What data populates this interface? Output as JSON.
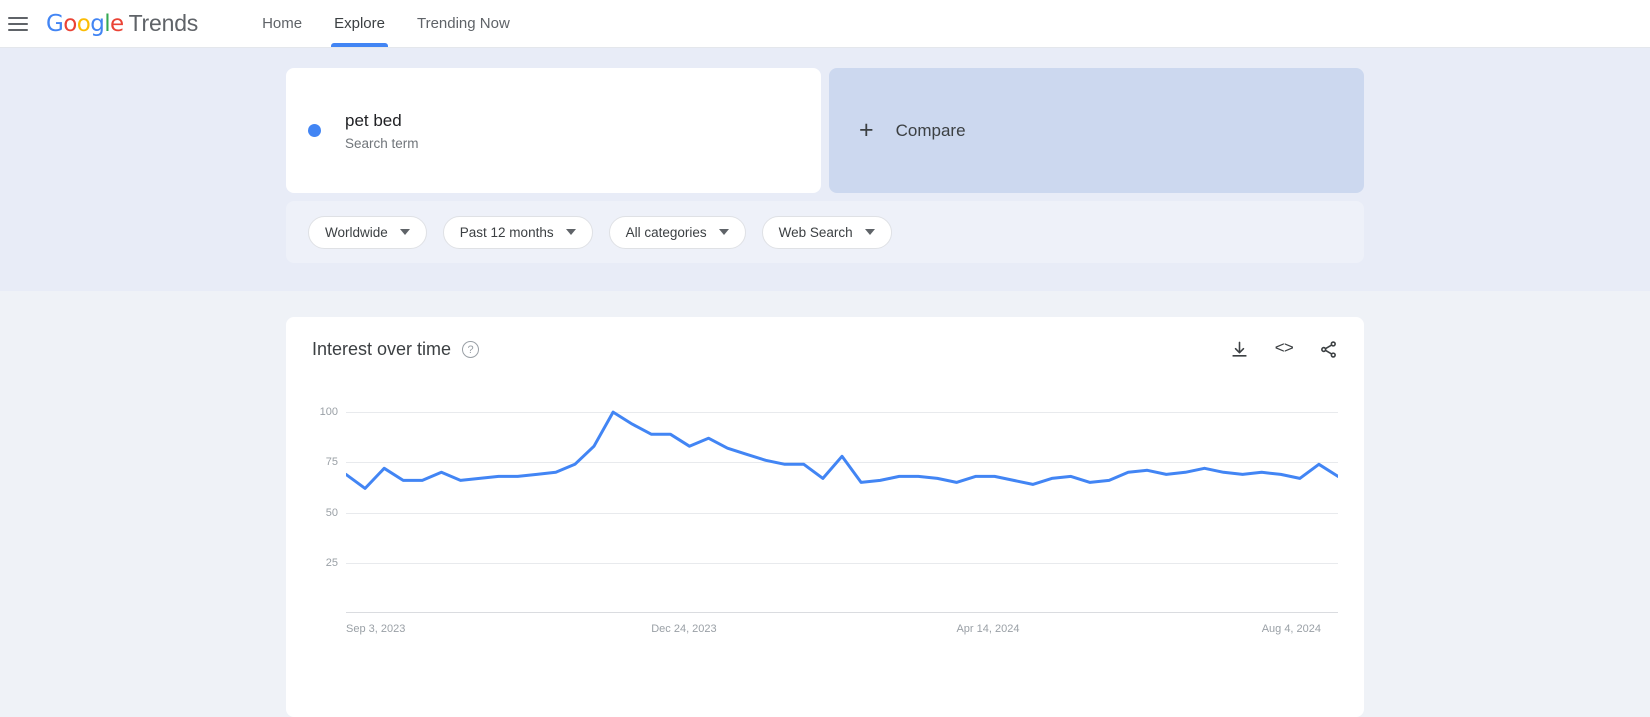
{
  "nav": {
    "menu_icon": "hamburger-icon",
    "logo_letters": [
      {
        "ch": "G",
        "color": "#4285F4"
      },
      {
        "ch": "o",
        "color": "#EA4335"
      },
      {
        "ch": "o",
        "color": "#FBBC05"
      },
      {
        "ch": "g",
        "color": "#4285F4"
      },
      {
        "ch": "l",
        "color": "#34A853"
      },
      {
        "ch": "e",
        "color": "#EA4335"
      }
    ],
    "brand_word": "Trends",
    "links": [
      {
        "label": "Home",
        "active": false
      },
      {
        "label": "Explore",
        "active": true
      },
      {
        "label": "Trending Now",
        "active": false
      }
    ]
  },
  "search_term": {
    "title": "pet bed",
    "subtitle": "Search term",
    "dot_color": "#4285F4"
  },
  "compare": {
    "plus": "+",
    "label": "Compare"
  },
  "filters": [
    {
      "label": "Worldwide"
    },
    {
      "label": "Past 12 months"
    },
    {
      "label": "All categories"
    },
    {
      "label": "Web Search"
    }
  ],
  "chart_card": {
    "title": "Interest over time",
    "help_glyph": "?",
    "actions": [
      {
        "name": "download-icon"
      },
      {
        "name": "embed-icon",
        "glyph": "<>"
      },
      {
        "name": "share-icon"
      }
    ]
  },
  "chart_data": {
    "type": "line",
    "title": "Interest over time",
    "xlabel": "",
    "ylabel": "",
    "ylim": [
      0,
      107
    ],
    "yticks": [
      100,
      75,
      50,
      25
    ],
    "grid": true,
    "legend": false,
    "line_color": "#4285F4",
    "xtick_labels": [
      "Sep 3, 2023",
      "Dec 24, 2023",
      "Apr 14, 2024",
      "Aug 4, 2024"
    ],
    "xtick_positions": [
      0,
      16,
      32,
      48
    ],
    "x": [
      "Sep 3, 2023",
      "Sep 10, 2023",
      "Sep 17, 2023",
      "Sep 24, 2023",
      "Oct 1, 2023",
      "Oct 8, 2023",
      "Oct 15, 2023",
      "Oct 22, 2023",
      "Oct 29, 2023",
      "Nov 5, 2023",
      "Nov 12, 2023",
      "Nov 19, 2023",
      "Nov 26, 2023",
      "Dec 3, 2023",
      "Dec 10, 2023",
      "Dec 17, 2023",
      "Dec 24, 2023",
      "Dec 31, 2023",
      "Jan 7, 2024",
      "Jan 14, 2024",
      "Jan 21, 2024",
      "Jan 28, 2024",
      "Feb 4, 2024",
      "Feb 11, 2024",
      "Feb 18, 2024",
      "Feb 25, 2024",
      "Mar 3, 2024",
      "Mar 10, 2024",
      "Mar 17, 2024",
      "Mar 24, 2024",
      "Mar 31, 2024",
      "Apr 7, 2024",
      "Apr 14, 2024",
      "Apr 21, 2024",
      "Apr 28, 2024",
      "May 5, 2024",
      "May 12, 2024",
      "May 19, 2024",
      "May 26, 2024",
      "Jun 2, 2024",
      "Jun 9, 2024",
      "Jun 16, 2024",
      "Jun 23, 2024",
      "Jun 30, 2024",
      "Jul 7, 2024",
      "Jul 14, 2024",
      "Jul 21, 2024",
      "Jul 28, 2024",
      "Aug 4, 2024",
      "Aug 11, 2024",
      "Aug 18, 2024",
      "Aug 25, 2024",
      "Sep 1, 2024"
    ],
    "values": [
      69,
      62,
      72,
      66,
      66,
      70,
      66,
      67,
      68,
      68,
      69,
      70,
      74,
      83,
      100,
      94,
      89,
      89,
      83,
      87,
      82,
      79,
      76,
      74,
      74,
      67,
      78,
      65,
      66,
      68,
      68,
      67,
      65,
      68,
      68,
      66,
      64,
      67,
      68,
      65,
      66,
      70,
      71,
      69,
      70,
      72,
      70,
      69,
      70,
      69,
      67,
      74,
      68
    ],
    "series_name": "pet bed"
  }
}
